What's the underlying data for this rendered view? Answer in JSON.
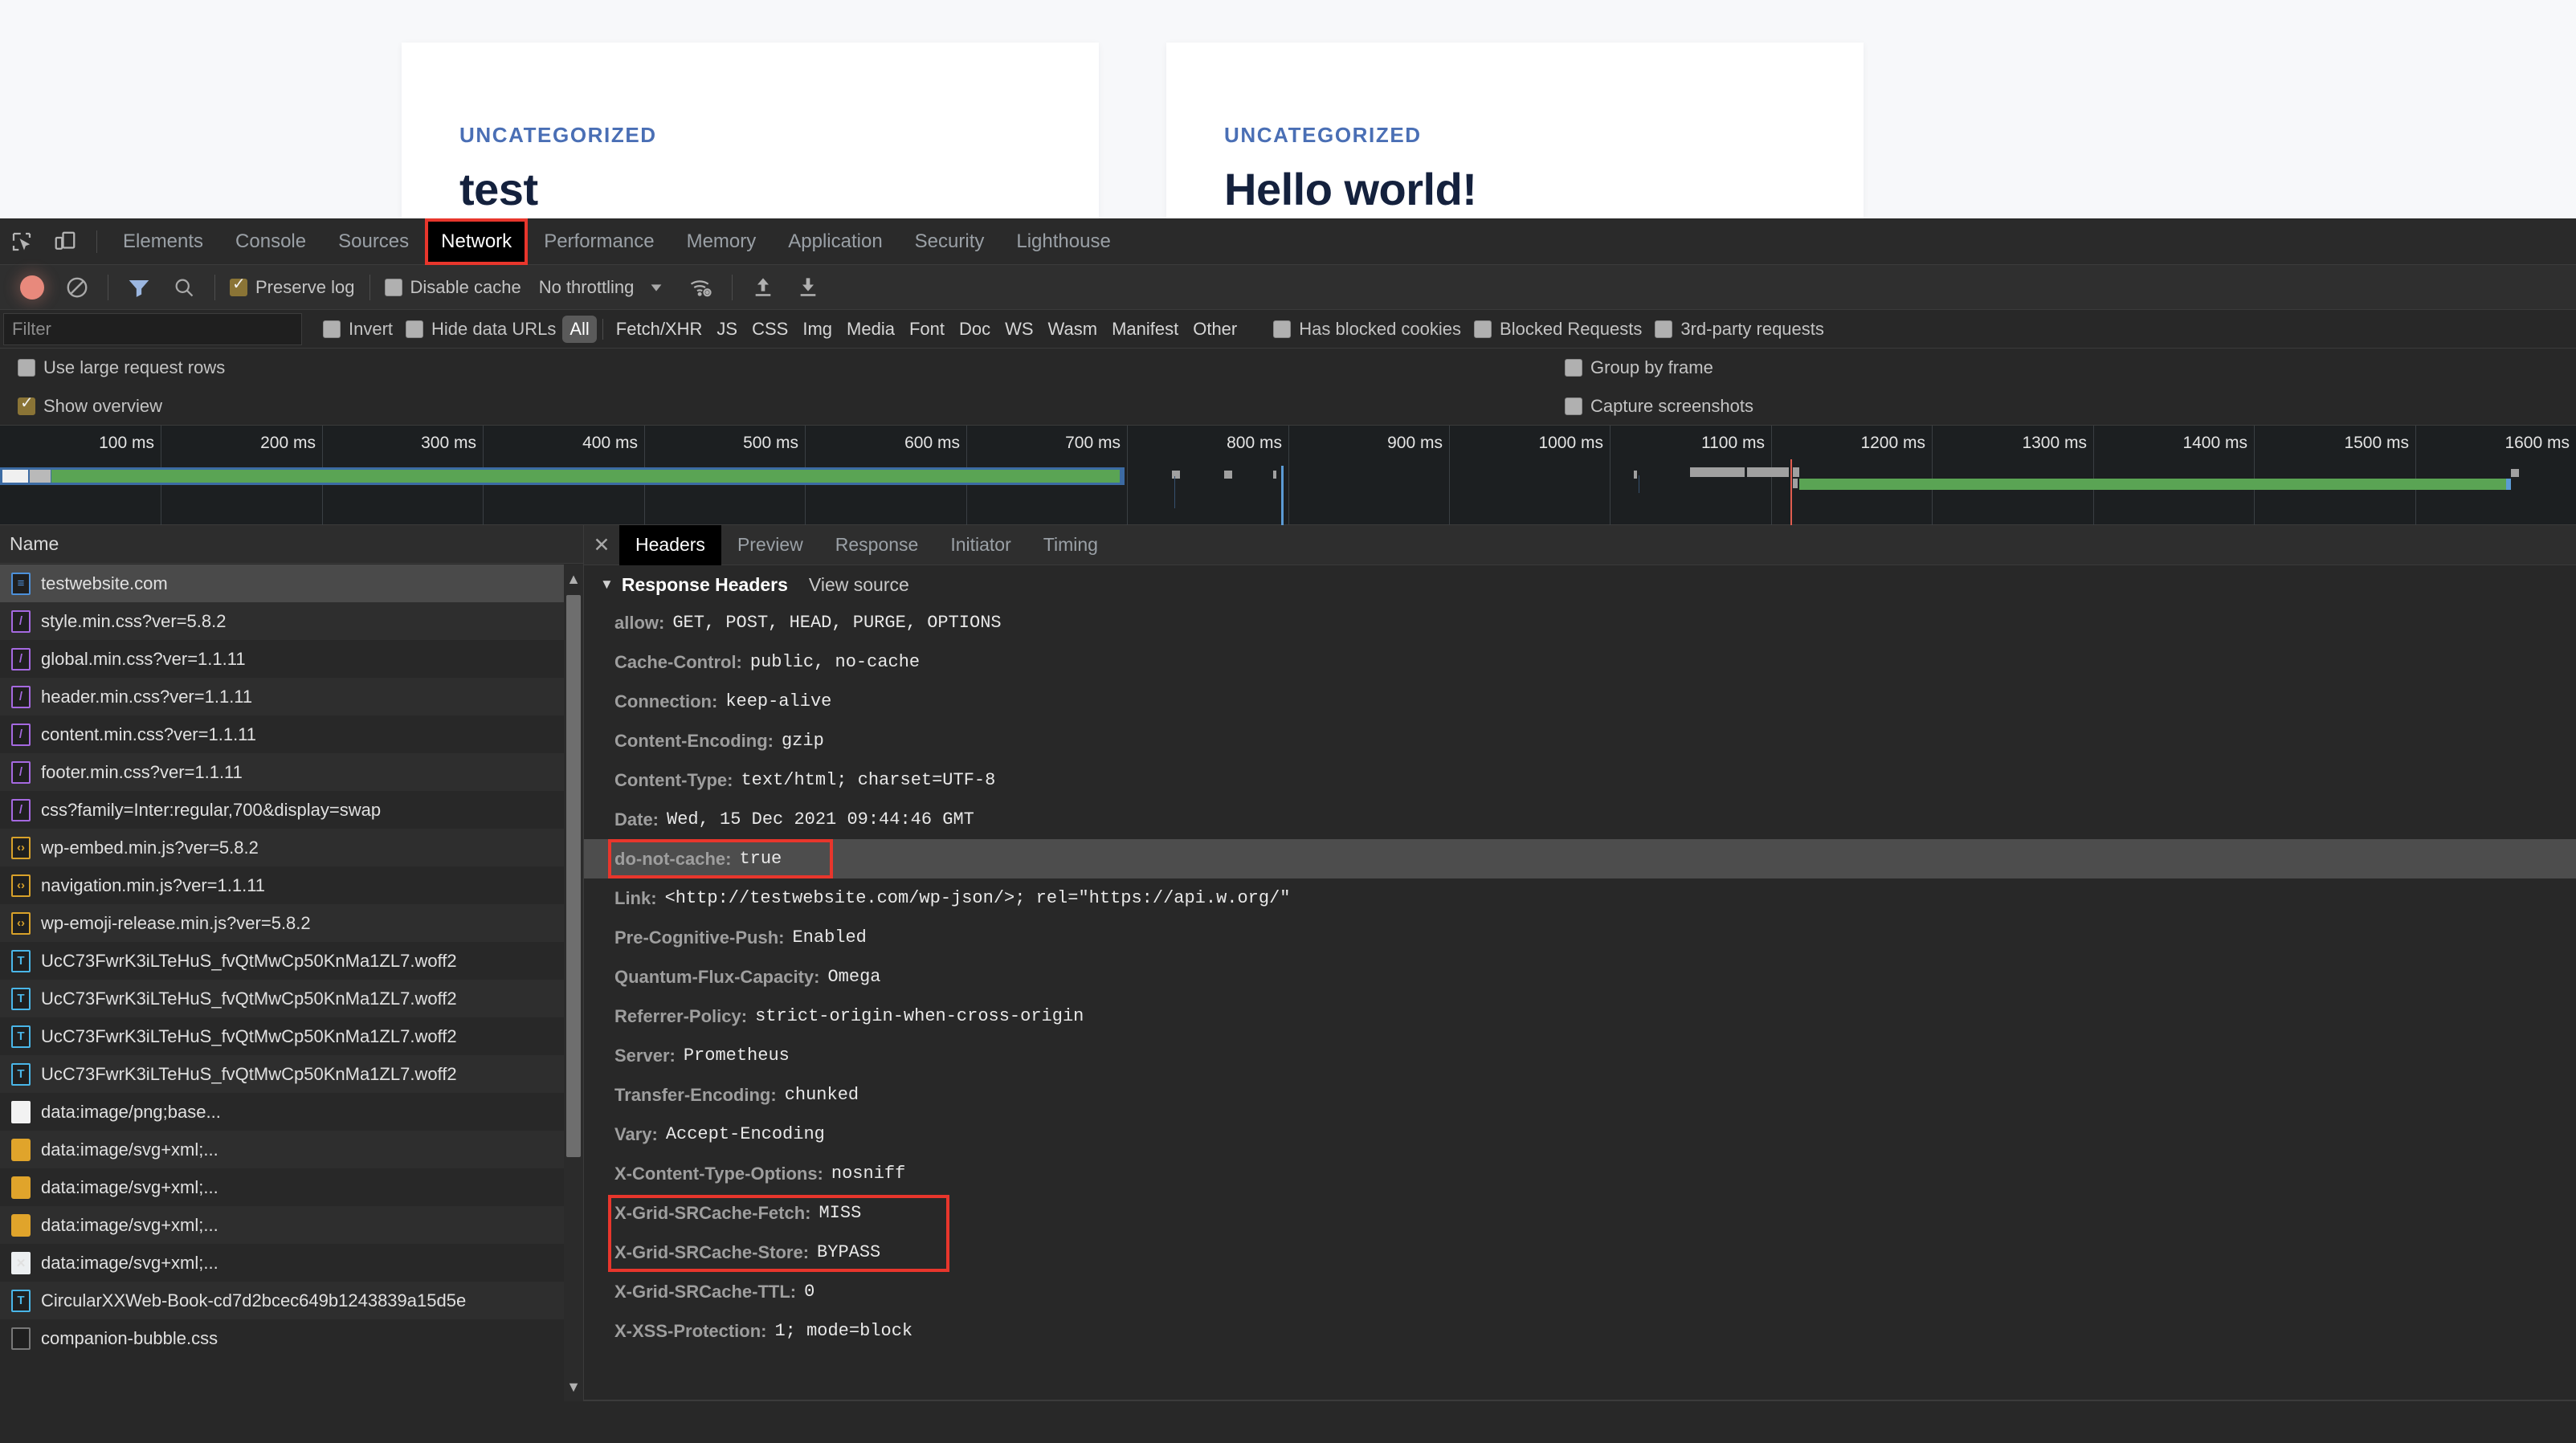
{
  "webpage": {
    "background_color": "#f7f8fa",
    "cards": [
      {
        "category": "UNCATEGORIZED",
        "title": "test"
      },
      {
        "category": "UNCATEGORIZED",
        "title": "Hello world!"
      }
    ]
  },
  "devtools": {
    "tabs": [
      {
        "label": "Elements",
        "active": false
      },
      {
        "label": "Console",
        "active": false
      },
      {
        "label": "Sources",
        "active": false
      },
      {
        "label": "Network",
        "active": true,
        "highlighted": true
      },
      {
        "label": "Performance",
        "active": false
      },
      {
        "label": "Memory",
        "active": false
      },
      {
        "label": "Application",
        "active": false
      },
      {
        "label": "Security",
        "active": false
      },
      {
        "label": "Lighthouse",
        "active": false
      }
    ],
    "toolbar": {
      "record_state": "recording",
      "preserve_log_label": "Preserve log",
      "preserve_log_checked": true,
      "disable_cache_label": "Disable cache",
      "disable_cache_checked": false,
      "throttling_value": "No throttling"
    },
    "filterbar": {
      "filter_placeholder": "Filter",
      "filter_value": "",
      "invert_label": "Invert",
      "invert_checked": false,
      "hide_data_urls_label": "Hide data URLs",
      "hide_data_urls_checked": false,
      "types": [
        "All",
        "Fetch/XHR",
        "JS",
        "CSS",
        "Img",
        "Media",
        "Font",
        "Doc",
        "WS",
        "Wasm",
        "Manifest",
        "Other"
      ],
      "selected_type": "All",
      "has_blocked_cookies_label": "Has blocked cookies",
      "has_blocked_cookies_checked": false,
      "blocked_requests_label": "Blocked Requests",
      "blocked_requests_checked": false,
      "third_party_label": "3rd-party requests",
      "third_party_checked": false
    },
    "settings": {
      "use_large_rows_label": "Use large request rows",
      "use_large_rows_checked": false,
      "group_by_frame_label": "Group by frame",
      "group_by_frame_checked": false,
      "show_overview_label": "Show overview",
      "show_overview_checked": true,
      "capture_screenshots_label": "Capture screenshots",
      "capture_screenshots_checked": false
    },
    "overview": {
      "tick_labels": [
        "100 ms",
        "200 ms",
        "300 ms",
        "400 ms",
        "500 ms",
        "600 ms",
        "700 ms",
        "800 ms",
        "900 ms",
        "1000 ms",
        "1100 ms",
        "1200 ms",
        "1300 ms",
        "1400 ms",
        "1500 ms",
        "1600 ms"
      ],
      "colors": {
        "blue": "#3c6ba3",
        "green": "#5aa454",
        "gray": "#a0a0a0",
        "red_marker": "#e05c4f",
        "blue_marker": "#5b9bd5"
      }
    },
    "request_list": {
      "column_header": "Name",
      "rows": [
        {
          "name": "testwebsite.com",
          "type": "doc",
          "selected": true
        },
        {
          "name": "style.min.css?ver=5.8.2",
          "type": "css",
          "selected": false
        },
        {
          "name": "global.min.css?ver=1.1.11",
          "type": "css",
          "selected": false
        },
        {
          "name": "header.min.css?ver=1.1.11",
          "type": "css",
          "selected": false
        },
        {
          "name": "content.min.css?ver=1.1.11",
          "type": "css",
          "selected": false
        },
        {
          "name": "footer.min.css?ver=1.1.11",
          "type": "css",
          "selected": false
        },
        {
          "name": "css?family=Inter:regular,700&display=swap",
          "type": "css",
          "selected": false
        },
        {
          "name": "wp-embed.min.js?ver=5.8.2",
          "type": "js",
          "selected": false
        },
        {
          "name": "navigation.min.js?ver=1.1.11",
          "type": "js",
          "selected": false
        },
        {
          "name": "wp-emoji-release.min.js?ver=5.8.2",
          "type": "js",
          "selected": false
        },
        {
          "name": "UcC73FwrK3iLTeHuS_fvQtMwCp50KnMa1ZL7.woff2",
          "type": "font",
          "selected": false
        },
        {
          "name": "UcC73FwrK3iLTeHuS_fvQtMwCp50KnMa1ZL7.woff2",
          "type": "font",
          "selected": false
        },
        {
          "name": "UcC73FwrK3iLTeHuS_fvQtMwCp50KnMa1ZL7.woff2",
          "type": "font",
          "selected": false
        },
        {
          "name": "UcC73FwrK3iLTeHuS_fvQtMwCp50KnMa1ZL7.woff2",
          "type": "font",
          "selected": false
        },
        {
          "name": "data:image/png;base...",
          "type": "img",
          "selected": false
        },
        {
          "name": "data:image/svg+xml;...",
          "type": "svg",
          "selected": false
        },
        {
          "name": "data:image/svg+xml;...",
          "type": "svg",
          "selected": false
        },
        {
          "name": "data:image/svg+xml;...",
          "type": "svg",
          "selected": false
        },
        {
          "name": "data:image/svg+xml;...",
          "type": "xsvg",
          "selected": false
        },
        {
          "name": "CircularXXWeb-Book-cd7d2bcec649b1243839a15d5e",
          "type": "font",
          "selected": false
        },
        {
          "name": "companion-bubble.css",
          "type": "plain",
          "selected": false
        }
      ]
    },
    "detail": {
      "tabs": [
        {
          "label": "Headers",
          "active": true
        },
        {
          "label": "Preview",
          "active": false
        },
        {
          "label": "Response",
          "active": false
        },
        {
          "label": "Initiator",
          "active": false
        },
        {
          "label": "Timing",
          "active": false
        }
      ],
      "section_title": "Response Headers",
      "view_source_label": "View source",
      "headers": [
        {
          "key": "allow:",
          "value": "GET, POST, HEAD, PURGE, OPTIONS",
          "highlighted": false
        },
        {
          "key": "Cache-Control:",
          "value": "public, no-cache",
          "highlighted": false
        },
        {
          "key": "Connection:",
          "value": "keep-alive",
          "highlighted": false
        },
        {
          "key": "Content-Encoding:",
          "value": "gzip",
          "highlighted": false
        },
        {
          "key": "Content-Type:",
          "value": "text/html; charset=UTF-8",
          "highlighted": false
        },
        {
          "key": "Date:",
          "value": "Wed, 15 Dec 2021 09:44:46 GMT",
          "highlighted": false
        },
        {
          "key": "do-not-cache:",
          "value": "true",
          "highlighted": true
        },
        {
          "key": "Link:",
          "value": "<http://testwebsite.com/wp-json/>; rel=\"https://api.w.org/\"",
          "highlighted": false
        },
        {
          "key": "Pre-Cognitive-Push:",
          "value": "Enabled",
          "highlighted": false
        },
        {
          "key": "Quantum-Flux-Capacity:",
          "value": "Omega",
          "highlighted": false
        },
        {
          "key": "Referrer-Policy:",
          "value": "strict-origin-when-cross-origin",
          "highlighted": false
        },
        {
          "key": "Server:",
          "value": "Prometheus",
          "highlighted": false
        },
        {
          "key": "Transfer-Encoding:",
          "value": "chunked",
          "highlighted": false
        },
        {
          "key": "Vary:",
          "value": "Accept-Encoding",
          "highlighted": false
        },
        {
          "key": "X-Content-Type-Options:",
          "value": "nosniff",
          "highlighted": false
        },
        {
          "key": "X-Grid-SRCache-Fetch:",
          "value": "MISS",
          "highlighted": false
        },
        {
          "key": "X-Grid-SRCache-Store:",
          "value": "BYPASS",
          "highlighted": false
        },
        {
          "key": "X-Grid-SRCache-TTL:",
          "value": "0",
          "highlighted": false
        },
        {
          "key": "X-XSS-Protection:",
          "value": "1; mode=block",
          "highlighted": false
        }
      ]
    },
    "annotations": {
      "highlight_color": "#e8362c"
    }
  }
}
